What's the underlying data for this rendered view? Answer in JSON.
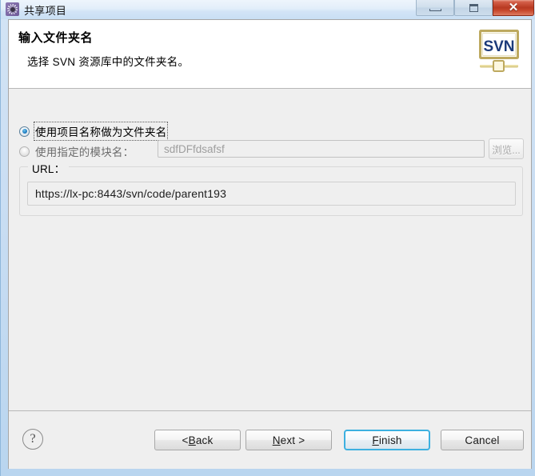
{
  "window": {
    "title": "共享项目",
    "icon": "gear-icon",
    "controls": {
      "minimize": "minimize-icon",
      "maximize": "maximize-icon",
      "close": "✕"
    },
    "colors": {
      "frame": "#cadef3",
      "client_bg": "#efefef",
      "header_bg": "#ffffff",
      "close_button": "#b83a22",
      "default_button_border": "#3cb0e0",
      "radio_accent": "#1e7cc0"
    }
  },
  "header": {
    "title": "输入文件夹名",
    "description": "选择 SVN 资源库中的文件夹名。",
    "logo": {
      "name": "svn-logo-icon",
      "text": "SVN"
    }
  },
  "options": [
    {
      "label": "使用项目名称做为文件夹名",
      "selected": true,
      "focused": true,
      "enabled": true
    },
    {
      "label": "使用指定的模块名：",
      "selected": false,
      "focused": false,
      "enabled": false
    }
  ],
  "module_field": {
    "value": "",
    "placeholder": "sdfDFfdsafsf",
    "enabled": false
  },
  "browse_button": {
    "label": "浏览...",
    "enabled": false
  },
  "url_group": {
    "label": "URL：",
    "value": "https://lx-pc:8443/svn/code/parent193"
  },
  "buttons": {
    "help": "?",
    "back": "< Back",
    "back_pre": "< ",
    "back_mnemonic": "B",
    "back_post": "ack",
    "next": "Next >",
    "next_mnemonic": "N",
    "next_post": "ext >",
    "finish": "Finish",
    "finish_mnemonic": "F",
    "finish_post": "inish",
    "cancel": "Cancel",
    "default": "Finish"
  }
}
